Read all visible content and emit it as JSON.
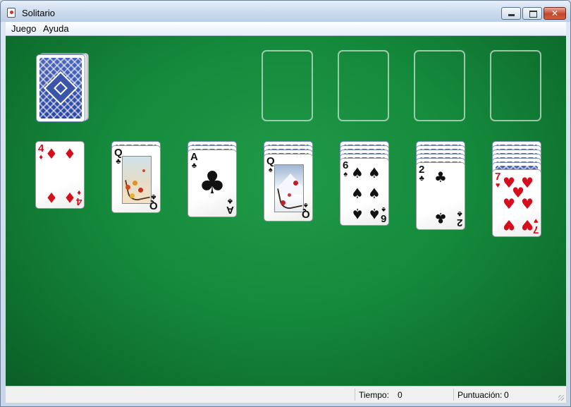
{
  "window": {
    "title": "Solitario",
    "title_icon": "cards-app-icon"
  },
  "window_controls": {
    "minimize_icon": "minimize-icon",
    "maximize_icon": "maximize-icon",
    "close_label": "✕"
  },
  "menu": {
    "items": [
      {
        "label": "Juego"
      },
      {
        "label": "Ayuda"
      }
    ]
  },
  "table": {
    "felt_color": "#178f40"
  },
  "stock": {
    "card_back": "blue ornamental",
    "has_cards": true
  },
  "foundations": {
    "count": 4,
    "state": "empty"
  },
  "tableau": [
    {
      "pile": 1,
      "hidden_cards": 0,
      "face_up": {
        "rank": "4",
        "suit": "♦",
        "color": "red"
      }
    },
    {
      "pile": 2,
      "hidden_cards": 1,
      "face_up": {
        "rank": "Q",
        "suit": "♣",
        "color": "black"
      }
    },
    {
      "pile": 3,
      "hidden_cards": 2,
      "face_up": {
        "rank": "A",
        "suit": "♣",
        "color": "black"
      }
    },
    {
      "pile": 4,
      "hidden_cards": 3,
      "face_up": {
        "rank": "Q",
        "suit": "♠",
        "color": "black"
      }
    },
    {
      "pile": 5,
      "hidden_cards": 4,
      "face_up": {
        "rank": "6",
        "suit": "♠",
        "color": "black"
      }
    },
    {
      "pile": 6,
      "hidden_cards": 5,
      "face_up": {
        "rank": "2",
        "suit": "♣",
        "color": "black"
      }
    },
    {
      "pile": 7,
      "hidden_cards": 6,
      "face_up": {
        "rank": "7",
        "suit": "♥",
        "color": "red"
      }
    }
  ],
  "status": {
    "time_label": "Tiempo:",
    "time_value": "0",
    "score_label": "Puntuación:",
    "score_value": "0"
  }
}
